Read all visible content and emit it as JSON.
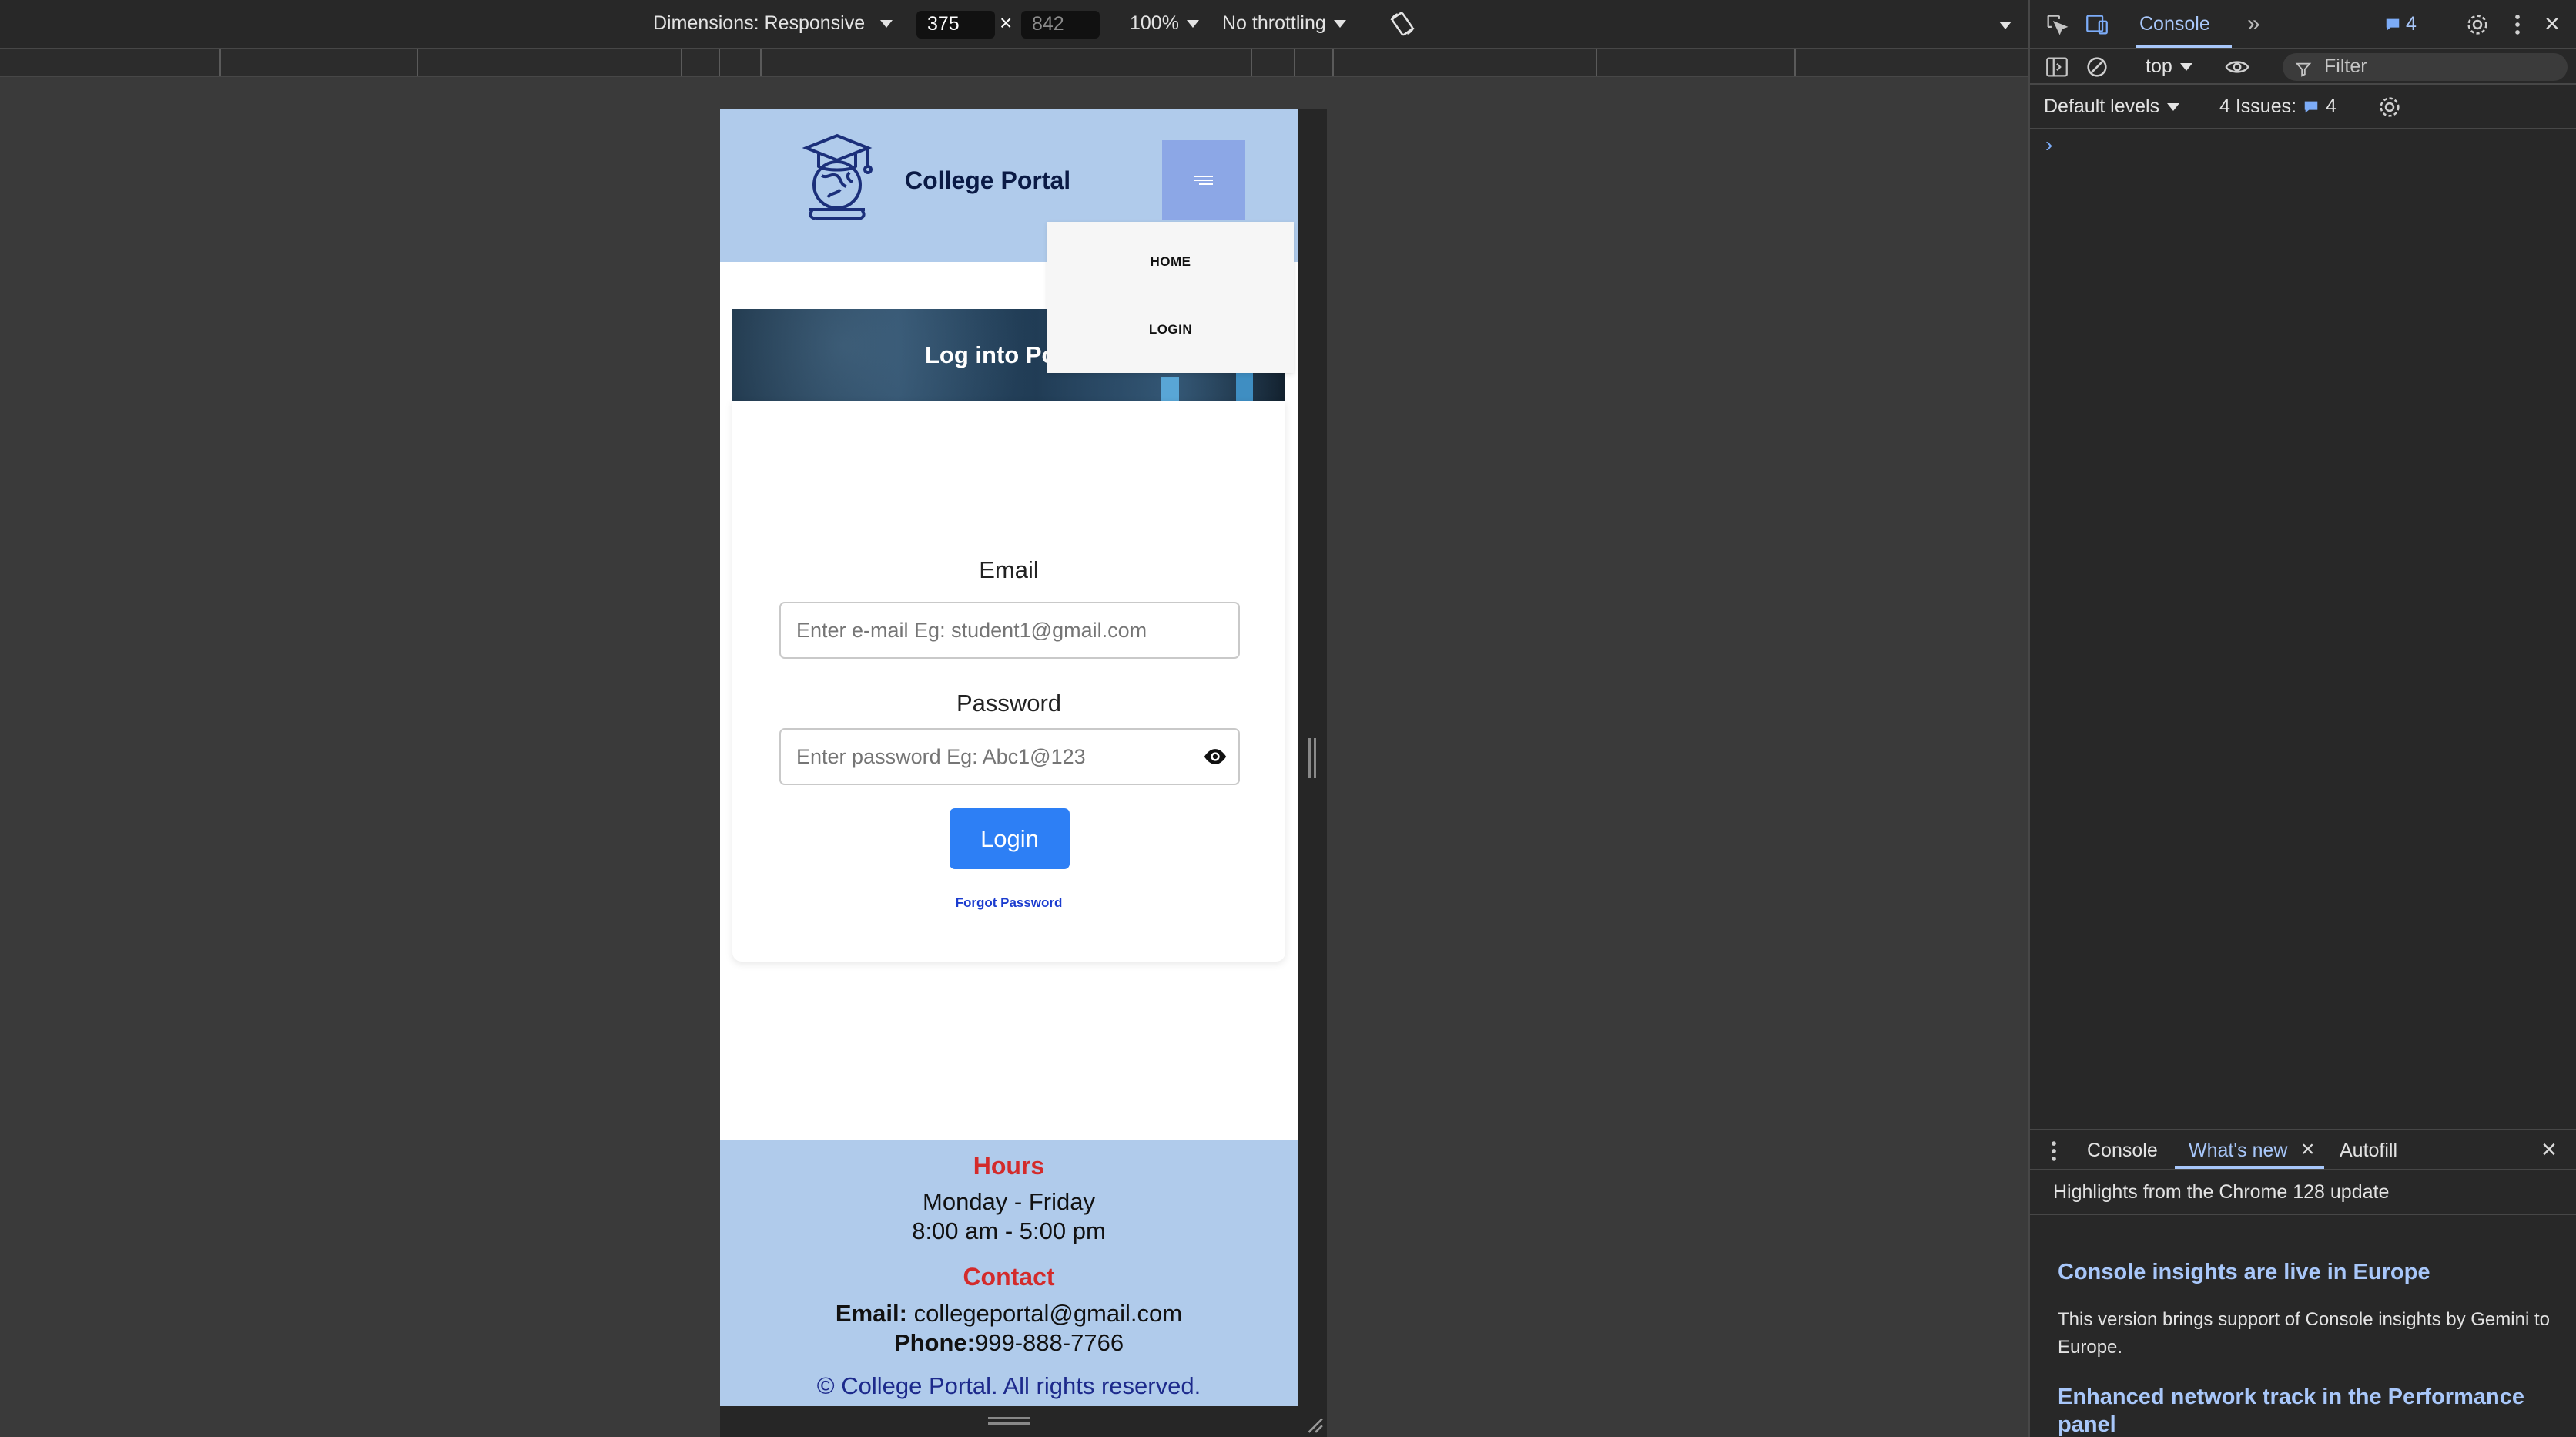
{
  "device_toolbar": {
    "dimensions_label": "Dimensions: Responsive",
    "width_value": "375",
    "height_value": "842",
    "separator": "×",
    "zoom_label": "100%",
    "throttle_label": "No throttling"
  },
  "site": {
    "title": "College Portal",
    "nav": {
      "home": "HOME",
      "login": "LOGIN"
    },
    "banner_title": "Log into Portal",
    "form": {
      "email_label": "Email",
      "email_placeholder": "Enter e-mail Eg: student1@gmail.com",
      "password_label": "Password",
      "password_placeholder": "Enter password Eg: Abc1@123",
      "login_button": "Login",
      "forgot_link": "Forgot Password"
    },
    "footer": {
      "hours_heading": "Hours",
      "days": "Monday - Friday",
      "time": "8:00 am - 5:00 pm",
      "contact_heading": "Contact",
      "email_key": "Email:",
      "email_value": "collegeportal@gmail.com",
      "phone_key": "Phone:",
      "phone_value": "999-888-7766",
      "copyright": "© College Portal. All rights reserved."
    }
  },
  "devtools": {
    "active_tab": "Console",
    "issues_badge": "4",
    "context": "top",
    "filter_placeholder": "Filter",
    "levels": "Default levels",
    "issues_label": "4 Issues:",
    "issues_count": "4",
    "prompt": "›",
    "drawer": {
      "tabs": [
        "Console",
        "What's new",
        "Autofill"
      ],
      "highlights": "Highlights from the Chrome 128 update",
      "news": [
        {
          "title": "Console insights are live in Europe",
          "body": "This version brings support of Console insights by Gemini to Europe."
        },
        {
          "title": "Enhanced network track in the Performance panel"
        }
      ]
    }
  },
  "colors": {
    "site_header_bg": "#b0cbeb",
    "hamburger_bg": "#8ca7e6",
    "login_button_bg": "#2d7ff5",
    "footer_heading": "#d32b2b",
    "devtools_accent": "#a8c7fa"
  }
}
